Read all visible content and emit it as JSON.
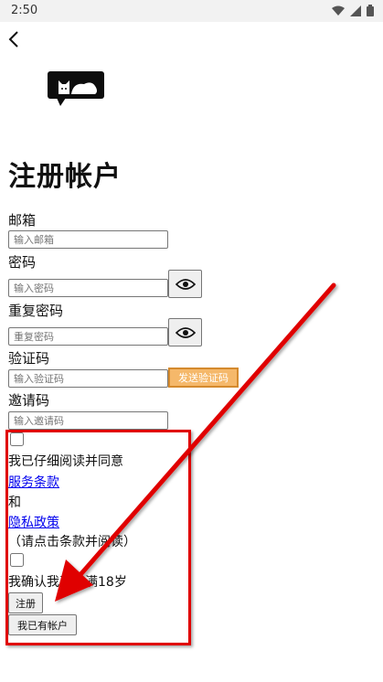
{
  "status_bar": {
    "time": "2:50"
  },
  "page": {
    "title": "注册帐户"
  },
  "form": {
    "email": {
      "label": "邮箱",
      "placeholder": "输入邮箱"
    },
    "password": {
      "label": "密码",
      "placeholder": "输入密码"
    },
    "confirm_password": {
      "label": "重复密码",
      "placeholder": "重复密码"
    },
    "verification": {
      "label": "验证码",
      "placeholder": "输入验证码",
      "send_button": "发送验证码"
    },
    "invite": {
      "label": "邀请码",
      "placeholder": "输入邀请码"
    }
  },
  "agreement": {
    "read_text": "我已仔细阅读并同意",
    "terms_link": "服务条款",
    "and_text": "和",
    "privacy_link": "隐私政策",
    "hint": "（请点击条款并阅读）",
    "age_text": "我确认我已年满18岁"
  },
  "buttons": {
    "register": "注册",
    "have_account": "我已有帐户"
  },
  "colors": {
    "send_button_bg": "#f5b86a",
    "highlight_border": "#e00000",
    "link": "#0000ee"
  }
}
